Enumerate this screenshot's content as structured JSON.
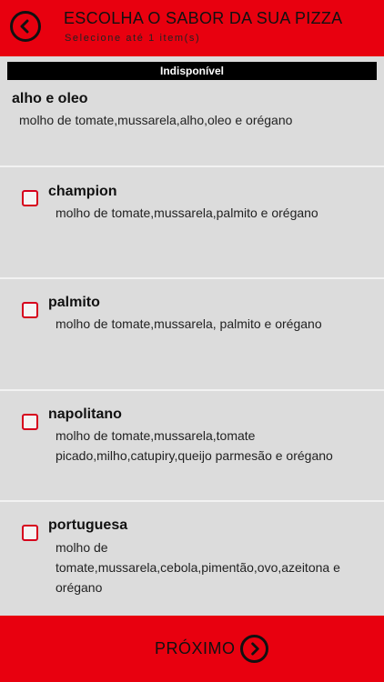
{
  "header": {
    "title": "ESCOLHA O SABOR DA SUA PIZZA",
    "subtitle": "Selecione até 1 item(s)"
  },
  "unavailable_label": "Indisponível",
  "items": [
    {
      "name": "alho e oleo",
      "description": "molho de tomate,mussarela,alho,oleo e orégano",
      "available": false
    },
    {
      "name": "champion",
      "description": "molho de tomate,mussarela,palmito e orégano",
      "available": true,
      "checked": false
    },
    {
      "name": "palmito",
      "description": "molho de tomate,mussarela, palmito e orégano",
      "available": true,
      "checked": false
    },
    {
      "name": "napolitano",
      "description": "molho de tomate,mussarela,tomate picado,milho,catupiry,queijo parmesão e orégano",
      "available": true,
      "checked": false
    },
    {
      "name": "portuguesa",
      "description": "molho de tomate,mussarela,cebola,pimentão,ovo,azeitona e orégano",
      "available": true,
      "checked": false
    }
  ],
  "footer": {
    "next_label": "PRÓXIMO"
  },
  "colors": {
    "brand_red": "#e8000f",
    "checkbox_red": "#d6001c",
    "background": "#dcdcdc"
  }
}
